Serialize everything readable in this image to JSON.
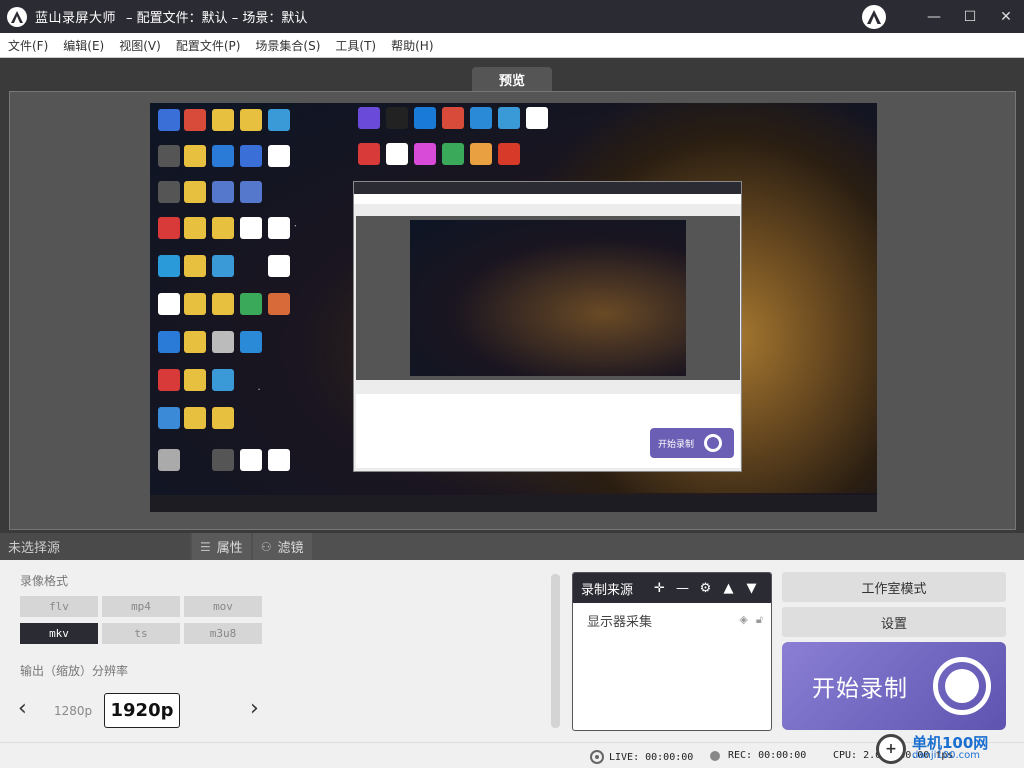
{
  "window": {
    "app_name": "蓝山录屏大师",
    "separator": "– 配置文件：默认 – 场景：默认",
    "minimize": "—",
    "maximize": "☐",
    "close": "✕"
  },
  "menu": [
    "文件(F)",
    "编辑(E)",
    "视图(V)",
    "配置文件(P)",
    "场景集合(S)",
    "工具(T)",
    "帮助(H)"
  ],
  "preview": {
    "tab_label": "预览",
    "nested_record_label": "开始录制"
  },
  "tabs": {
    "no_source": "未选择源",
    "properties": "属性",
    "filters": "滤镜"
  },
  "format": {
    "label": "录像格式",
    "options": [
      "flv",
      "mp4",
      "mov",
      "mkv",
      "ts",
      "m3u8"
    ],
    "selected": "mkv"
  },
  "resolution": {
    "label": "输出（缩放）分辨率",
    "prev_option": "1280p",
    "selected": "1920p"
  },
  "sources": {
    "title": "录制来源",
    "items": [
      {
        "name": "显示器采集"
      }
    ]
  },
  "actions": {
    "studio_mode": "工作室模式",
    "settings": "设置",
    "start_recording": "开始录制"
  },
  "status": {
    "live": "LIVE: 00:00:00",
    "rec": "REC: 00:00:00",
    "cpu": "CPU: 2.0%, 30.00 fps"
  },
  "watermark": {
    "main": "单机100网",
    "sub": "danji100.com"
  },
  "colors": {
    "titlebar": "#2b2b33",
    "record_button": "#6b5fb5"
  }
}
